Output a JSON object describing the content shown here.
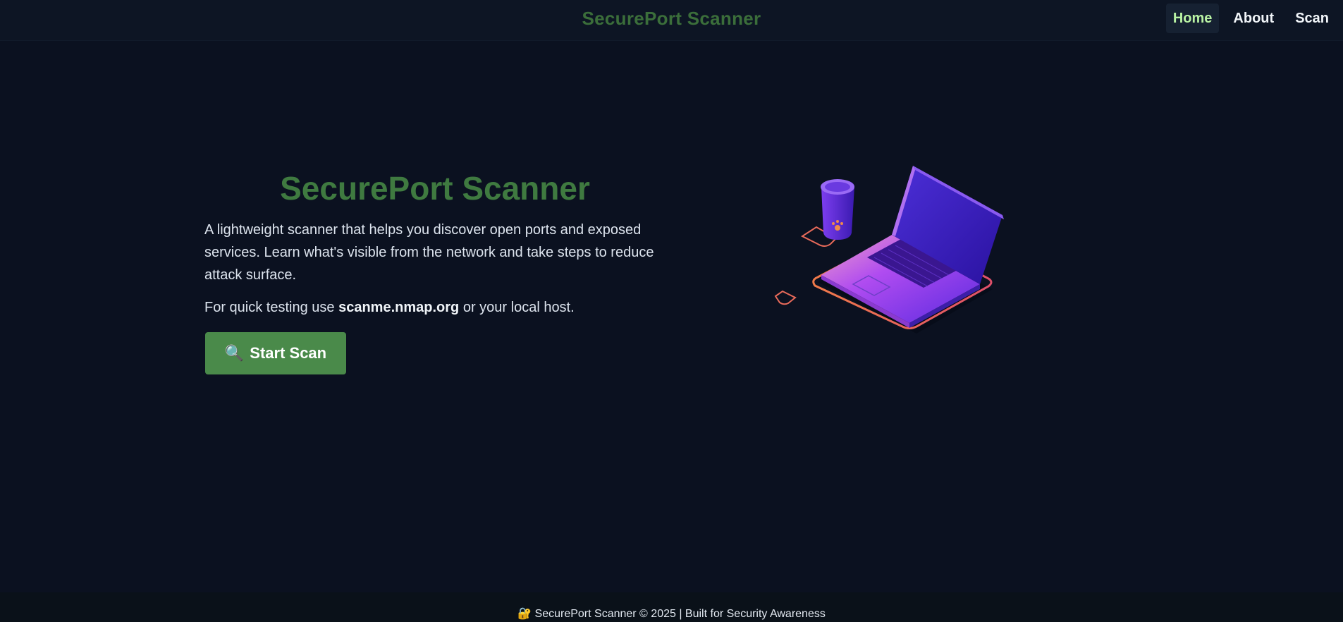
{
  "header": {
    "brand": "SecurePort Scanner",
    "nav": [
      {
        "label": "Home",
        "active": true
      },
      {
        "label": "About",
        "active": false
      },
      {
        "label": "Scan",
        "active": false
      }
    ]
  },
  "hero": {
    "title": "SecurePort Scanner",
    "description": "A lightweight scanner that helps you discover open ports and exposed services. Learn what's visible from the network and take steps to reduce attack surface.",
    "note_prefix": "For quick testing use ",
    "note_host": "scanme.nmap.org",
    "note_suffix": " or your local host.",
    "button_icon": "🔍",
    "button_label": "Start Scan"
  },
  "footer": {
    "icon": "🔐",
    "text": "SecurePort Scanner © 2025 | Built for Security Awareness"
  },
  "colors": {
    "background": "#0b1120",
    "brand_green": "#3f7a40",
    "button_green": "#4a8a4a",
    "active_nav_text": "#b9f3a4"
  },
  "icons": [
    "search-icon",
    "lock-icon",
    "laptop-illustration"
  ]
}
